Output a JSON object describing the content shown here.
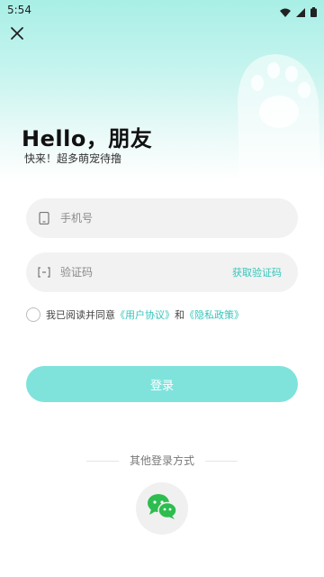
{
  "status": {
    "time": "5:54",
    "icons": [
      "wifi-icon",
      "signal-icon",
      "battery-icon"
    ]
  },
  "header": {
    "close_icon": "close-icon",
    "greeting": "Hello，朋友",
    "subtitle": "快来！超多萌宠待撸"
  },
  "form": {
    "phone_placeholder": "手机号",
    "code_placeholder": "验证码",
    "get_code_label": "获取验证码"
  },
  "agreement": {
    "prefix": "我已阅读并同意",
    "user_agreement": "《用户协议》",
    "and": "和",
    "privacy_policy": "《隐私政策》"
  },
  "login": {
    "button_label": "登录"
  },
  "other_login": {
    "label": "其他登录方式",
    "wechat_icon": "wechat-icon"
  },
  "colors": {
    "accent": "#36c5bb",
    "button": "#7fe3dc",
    "hero": "#a8efe6"
  }
}
